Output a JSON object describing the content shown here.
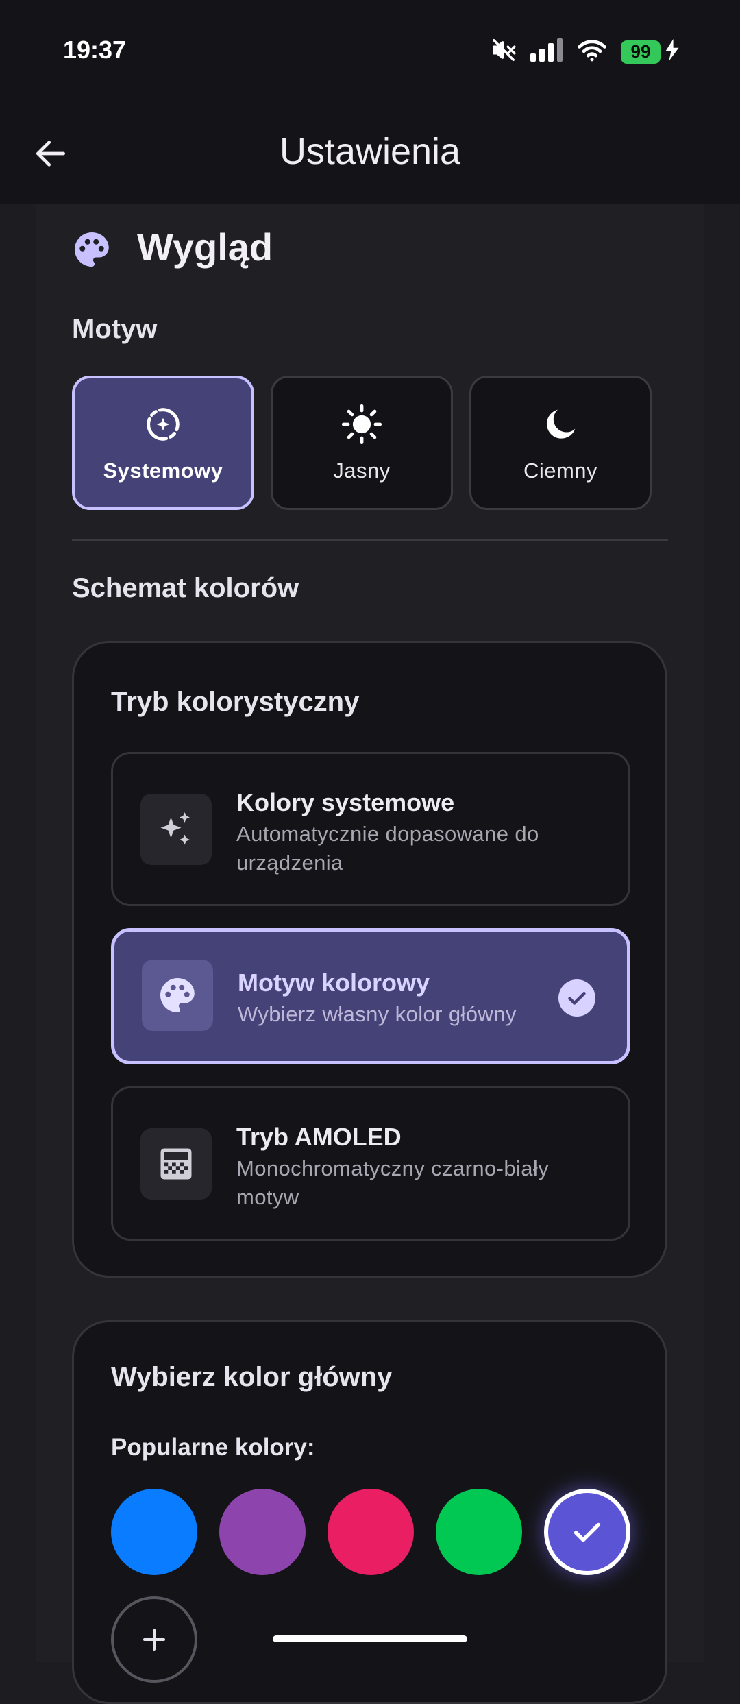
{
  "status_bar": {
    "time": "19:37",
    "battery": "99",
    "icons": [
      "mute-icon",
      "signal-icon",
      "wifi-icon",
      "battery-icon",
      "charging-bolt-icon"
    ]
  },
  "header": {
    "title": "Ustawienia",
    "back_icon": "arrow-left-icon"
  },
  "section": {
    "title": "Wygląd",
    "icon": "palette-icon"
  },
  "theme": {
    "label": "Motyw",
    "options": [
      {
        "label": "Systemowy",
        "icon": "system-theme-icon",
        "selected": true
      },
      {
        "label": "Jasny",
        "icon": "sun-icon",
        "selected": false
      },
      {
        "label": "Ciemny",
        "icon": "moon-icon",
        "selected": false
      }
    ]
  },
  "color_scheme": {
    "label": "Schemat kolorów",
    "mode_card": {
      "title": "Tryb kolorystyczny",
      "options": [
        {
          "title": "Kolory systemowe",
          "desc": "Automatycznie dopasowane do urządzenia",
          "icon": "sparkles-icon",
          "selected": false
        },
        {
          "title": "Motyw kolorowy",
          "desc": "Wybierz własny kolor główny",
          "icon": "palette-icon",
          "selected": true
        },
        {
          "title": "Tryb AMOLED",
          "desc": "Monochromatyczny czarno-biały motyw",
          "icon": "checkerboard-icon",
          "selected": false
        }
      ]
    },
    "primary_card": {
      "title": "Wybierz kolor główny",
      "popular_label": "Popularne kolory:",
      "swatches": [
        {
          "color": "#0a7cff",
          "selected": false
        },
        {
          "color": "#8e44ad",
          "selected": false
        },
        {
          "color": "#e91e63",
          "selected": false
        },
        {
          "color": "#00c853",
          "selected": false
        },
        {
          "color": "#5b55d6",
          "selected": true
        }
      ],
      "add_icon": "plus-icon"
    }
  },
  "colors": {
    "accent": "#c7c1ff",
    "selected_bg": "#454278",
    "background": "#1c1c21"
  }
}
